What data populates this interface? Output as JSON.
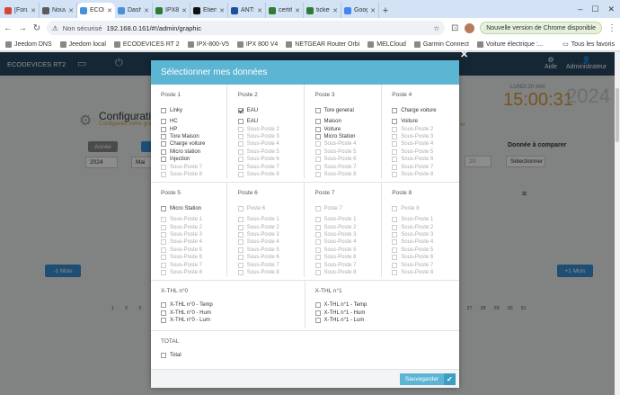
{
  "browser": {
    "tabs": [
      {
        "label": "[Forum",
        "color": "#d44638",
        "active": false
      },
      {
        "label": "Nouve",
        "color": "#5b5b5b",
        "active": false
      },
      {
        "label": "ECODE",
        "color": "#4a90d9",
        "active": true
      },
      {
        "label": "Dashb",
        "color": "#4a90d9",
        "active": false
      },
      {
        "label": "IPX800",
        "color": "#2e7d32",
        "active": false
      },
      {
        "label": "Etienn",
        "color": "#111111",
        "active": false
      },
      {
        "label": "ANTS",
        "color": "#1e4fa0",
        "active": false
      },
      {
        "label": "certific",
        "color": "#2e7d32",
        "active": false
      },
      {
        "label": "ticket",
        "color": "#2e7d32",
        "active": false
      },
      {
        "label": "Googl",
        "color": "#4285f4",
        "active": false
      }
    ],
    "security": "Non sécurisé",
    "url": "192.168.0.161/#!/admin/graphic",
    "update_label": "Nouvelle version de Chrome disponible",
    "bookmarks": [
      "Jeedom DNS",
      "Jeedom local",
      "ECODEVICES RT 2",
      "IPX-800-V5",
      "IPX 800 V4",
      "NETGEAR Router Orbi",
      "MELCloud",
      "Garmin Connect",
      "Voiture électrique :..."
    ],
    "all_bookmarks": "Tous les favoris"
  },
  "app": {
    "brand": "ECODEVICES RT2",
    "help": "Aide",
    "admin": "Administrateur",
    "date_day": "LUNDI 20 MAI",
    "time": "15:00:31",
    "year": "2024",
    "config_title": "Configuration",
    "config_sub": "Configurez votre graphique",
    "compare_label": "Donnée à comparer",
    "annee_btn": "Année",
    "year_value": "2024",
    "month_value": "Mai",
    "day_value": "20",
    "compare_select": "Sélectionner",
    "prev_month": "-1 Mois",
    "next_month": "+1 Mois",
    "pager_left": [
      "1",
      "2",
      "3",
      "4"
    ],
    "pager_right": [
      "24",
      "25",
      "26",
      "27",
      "28",
      "29",
      "30",
      "31"
    ]
  },
  "modal": {
    "title": "Sélectionner mes données",
    "save_label": "Sauvegarder",
    "postes_row1": [
      {
        "title": "Poste 1",
        "main": "Linky",
        "main_checked": false,
        "main_disabled": false,
        "subs": [
          [
            "HC",
            false
          ],
          [
            "HP",
            false
          ],
          [
            "Tore Maison",
            false
          ],
          [
            "Charge voiture",
            false
          ],
          [
            "Micro station",
            false
          ],
          [
            "Injection",
            false
          ],
          [
            "Sous-Poste 7",
            true
          ],
          [
            "Sous-Poste 8",
            true
          ]
        ]
      },
      {
        "title": "Poste 2",
        "main": "EAU",
        "main_checked": true,
        "main_disabled": false,
        "subs": [
          [
            "EAU",
            false
          ],
          [
            "Sous-Poste 2",
            true
          ],
          [
            "Sous-Poste 3",
            true
          ],
          [
            "Sous-Poste 4",
            true
          ],
          [
            "Sous-Poste 5",
            true
          ],
          [
            "Sous-Poste 6",
            true
          ],
          [
            "Sous-Poste 7",
            true
          ],
          [
            "Sous-Poste 8",
            true
          ]
        ]
      },
      {
        "title": "Poste 3",
        "main": "Tore general",
        "main_checked": false,
        "main_disabled": false,
        "subs": [
          [
            "Maison",
            false
          ],
          [
            "Voiture",
            false
          ],
          [
            "Micro Station",
            false
          ],
          [
            "Sous-Poste 4",
            true
          ],
          [
            "Sous-Poste 5",
            true
          ],
          [
            "Sous-Poste 6",
            true
          ],
          [
            "Sous-Poste 7",
            true
          ],
          [
            "Sous-Poste 8",
            true
          ]
        ]
      },
      {
        "title": "Poste 4",
        "main": "Charge voiture",
        "main_checked": false,
        "main_disabled": false,
        "subs": [
          [
            "Voiture",
            false
          ],
          [
            "Sous-Poste 2",
            true
          ],
          [
            "Sous-Poste 3",
            true
          ],
          [
            "Sous-Poste 4",
            true
          ],
          [
            "Sous-Poste 5",
            true
          ],
          [
            "Sous-Poste 6",
            true
          ],
          [
            "Sous-Poste 7",
            true
          ],
          [
            "Sous-Poste 8",
            true
          ]
        ]
      }
    ],
    "postes_row2": [
      {
        "title": "Poste 5",
        "main": "Micro Station",
        "main_checked": false,
        "main_disabled": false,
        "subs": [
          [
            "Sous-Poste 1",
            true
          ],
          [
            "Sous-Poste 2",
            true
          ],
          [
            "Sous-Poste 3",
            true
          ],
          [
            "Sous-Poste 4",
            true
          ],
          [
            "Sous-Poste 5",
            true
          ],
          [
            "Sous-Poste 6",
            true
          ],
          [
            "Sous-Poste 7",
            true
          ],
          [
            "Sous-Poste 8",
            true
          ]
        ]
      },
      {
        "title": "Poste 6",
        "main": "Poste 6",
        "main_checked": false,
        "main_disabled": true,
        "subs": [
          [
            "Sous-Poste 1",
            true
          ],
          [
            "Sous-Poste 2",
            true
          ],
          [
            "Sous-Poste 3",
            true
          ],
          [
            "Sous-Poste 4",
            true
          ],
          [
            "Sous-Poste 5",
            true
          ],
          [
            "Sous-Poste 6",
            true
          ],
          [
            "Sous-Poste 7",
            true
          ],
          [
            "Sous-Poste 8",
            true
          ]
        ]
      },
      {
        "title": "Poste 7",
        "main": "Poste 7",
        "main_checked": false,
        "main_disabled": true,
        "subs": [
          [
            "Sous-Poste 1",
            true
          ],
          [
            "Sous-Poste 2",
            true
          ],
          [
            "Sous-Poste 3",
            true
          ],
          [
            "Sous-Poste 4",
            true
          ],
          [
            "Sous-Poste 5",
            true
          ],
          [
            "Sous-Poste 6",
            true
          ],
          [
            "Sous-Poste 7",
            true
          ],
          [
            "Sous-Poste 8",
            true
          ]
        ]
      },
      {
        "title": "Poste 8",
        "main": "Poste 8",
        "main_checked": false,
        "main_disabled": true,
        "subs": [
          [
            "Sous-Poste 1",
            true
          ],
          [
            "Sous-Poste 2",
            true
          ],
          [
            "Sous-Poste 3",
            true
          ],
          [
            "Sous-Poste 4",
            true
          ],
          [
            "Sous-Poste 5",
            true
          ],
          [
            "Sous-Poste 6",
            true
          ],
          [
            "Sous-Poste 7",
            true
          ],
          [
            "Sous-Poste 8",
            true
          ]
        ]
      }
    ],
    "xthl": [
      {
        "title": "X-THL n°0",
        "items": [
          "X-THL n°0 - Temp",
          "X-THL n°0 - Hum",
          "X-THL n°0 - Lum"
        ]
      },
      {
        "title": "X-THL n°1",
        "items": [
          "X-THL n°1 - Temp",
          "X-THL n°1 - Hum",
          "X-THL n°1 - Lum"
        ]
      }
    ],
    "total": {
      "title": "TOTAL",
      "item": "Total"
    }
  }
}
